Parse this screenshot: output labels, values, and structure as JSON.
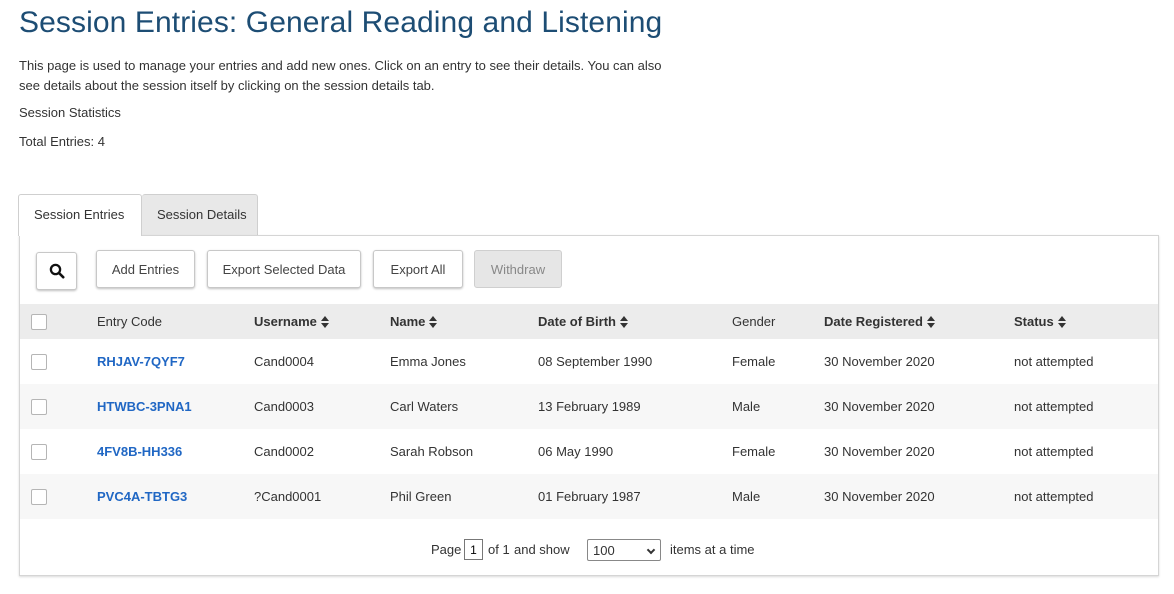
{
  "header": {
    "title": "Session Entries: General Reading and Listening",
    "intro": "This page is used to manage your entries and add new ones. Click on an entry to see their details. You can also see details about the session itself by clicking on the session details tab.",
    "stats_label": "Session Statistics",
    "total_entries": "Total Entries: 4"
  },
  "tabs": [
    {
      "label": "Session Entries",
      "active": true
    },
    {
      "label": "Session Details",
      "active": false
    }
  ],
  "toolbar": {
    "search_icon": "search-icon",
    "add_label": "Add Entries",
    "export_selected_label": "Export Selected Data",
    "export_all_label": "Export All",
    "withdraw_label": "Withdraw"
  },
  "table": {
    "columns": {
      "entry_code": "Entry Code",
      "username": "Username",
      "name": "Name",
      "dob": "Date of Birth",
      "gender": "Gender",
      "date_registered": "Date Registered",
      "status": "Status"
    },
    "rows": [
      {
        "entry_code": "RHJAV-7QYF7",
        "username": "Cand0004",
        "name": "Emma Jones",
        "dob": "08 September 1990",
        "gender": "Female",
        "date_registered": "30 November 2020",
        "status": "not attempted"
      },
      {
        "entry_code": "HTWBC-3PNA1",
        "username": "Cand0003",
        "name": "Carl Waters",
        "dob": "13 February 1989",
        "gender": "Male",
        "date_registered": "30 November 2020",
        "status": "not attempted"
      },
      {
        "entry_code": "4FV8B-HH336",
        "username": "Cand0002",
        "name": "Sarah Robson",
        "dob": "06 May 1990",
        "gender": "Female",
        "date_registered": "30 November 2020",
        "status": "not attempted"
      },
      {
        "entry_code": "PVC4A-TBTG3",
        "username": "?Cand0001",
        "name": "Phil Green",
        "dob": "01 February 1987",
        "gender": "Male",
        "date_registered": "30 November 2020",
        "status": "not attempted"
      }
    ]
  },
  "pager": {
    "page_label": "Page",
    "page_value": "1",
    "of_label": "of 1",
    "show_label": "and show",
    "page_size": "100",
    "items_label": "items at a time"
  },
  "colors": {
    "title": "#1d4d74",
    "link": "#2067c4",
    "header_bg": "#ececec"
  }
}
